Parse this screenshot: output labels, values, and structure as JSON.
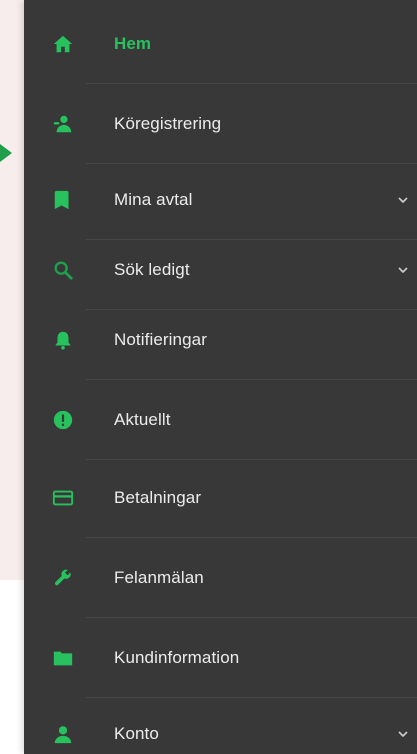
{
  "accent_color": "#27c15d",
  "sidebar_background": "#383838",
  "text_color": "#ececec",
  "nav": {
    "items": [
      {
        "label": "Hem",
        "icon": "home-icon",
        "active": true,
        "expandable": false
      },
      {
        "label": "Köregistrering",
        "icon": "queue-person-icon",
        "active": false,
        "expandable": false
      },
      {
        "label": "Mina avtal",
        "icon": "document-icon",
        "active": false,
        "expandable": true
      },
      {
        "label": "Sök ledigt",
        "icon": "search-icon",
        "active": false,
        "expandable": true
      },
      {
        "label": "Notifieringar",
        "icon": "bell-icon",
        "active": false,
        "expandable": false
      },
      {
        "label": "Aktuellt",
        "icon": "info-icon",
        "active": false,
        "expandable": false
      },
      {
        "label": "Betalningar",
        "icon": "credit-card-icon",
        "active": false,
        "expandable": false
      },
      {
        "label": "Felanmälan",
        "icon": "wrench-icon",
        "active": false,
        "expandable": false
      },
      {
        "label": "Kundinformation",
        "icon": "folder-icon",
        "active": false,
        "expandable": false
      },
      {
        "label": "Konto",
        "icon": "user-icon",
        "active": false,
        "expandable": true
      }
    ]
  }
}
